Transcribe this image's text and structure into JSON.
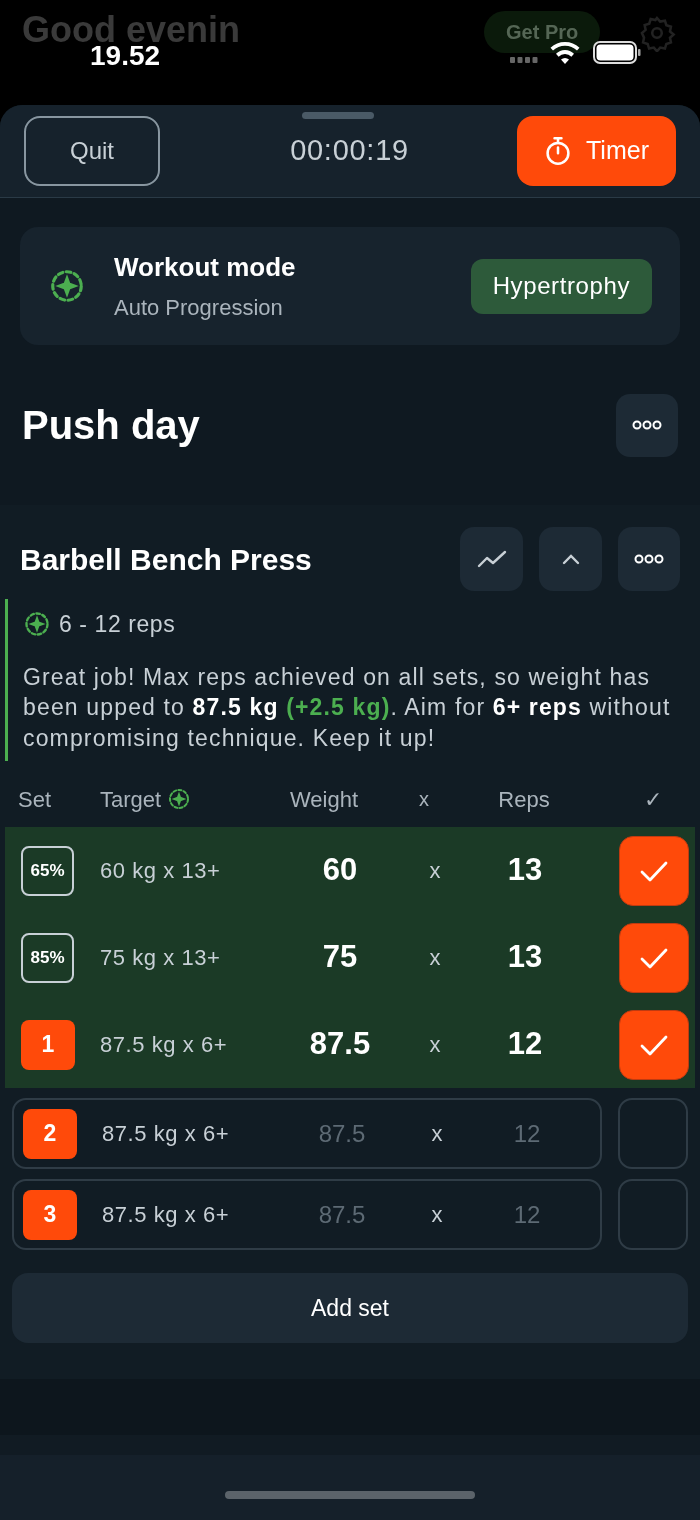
{
  "background": {
    "greeting": "Good evenin",
    "pro_button": "Get Pro"
  },
  "status_bar": {
    "time": "19.52"
  },
  "header": {
    "quit": "Quit",
    "elapsed": "00:00:19",
    "timer": "Timer"
  },
  "mode_card": {
    "title": "Workout mode",
    "subtitle": "Auto Progression",
    "mode": "Hypertrophy"
  },
  "workout": {
    "title": "Push day"
  },
  "exercise": {
    "title": "Barbell Bench Press",
    "rep_range": "6 - 12 reps",
    "note": [
      {
        "kind": "plain",
        "text": "Great job! Max reps achieved on all sets, so weight has been upped to **87.5 kg** "
      },
      {
        "kind": "gain",
        "text": "(+2.5 kg)"
      },
      {
        "kind": "plain",
        "text": ". Aim for **6+ reps** without compromising technique. Keep it up!"
      }
    ],
    "columns": [
      "Set",
      "Target",
      "Weight",
      "x",
      "Reps",
      "✓"
    ],
    "sets": [
      {
        "kind": "warmup",
        "label": "65%",
        "target": "60 kg x 13+",
        "weight": "60",
        "times": "x",
        "reps": "13",
        "completed": true
      },
      {
        "kind": "warmup",
        "label": "85%",
        "target": "75 kg x 13+",
        "weight": "75",
        "times": "x",
        "reps": "13",
        "completed": true
      },
      {
        "kind": "working",
        "label": "1",
        "target": "87.5 kg x 6+",
        "weight": "87.5",
        "times": "x",
        "reps": "12",
        "completed": true
      },
      {
        "kind": "working",
        "label": "2",
        "target": "87.5 kg x 6+",
        "weight": "87.5",
        "times": "x",
        "reps": "12",
        "completed": false
      },
      {
        "kind": "working",
        "label": "3",
        "target": "87.5 kg x 6+",
        "weight": "87.5",
        "times": "x",
        "reps": "12",
        "completed": false
      }
    ],
    "add_set": "Add set"
  }
}
